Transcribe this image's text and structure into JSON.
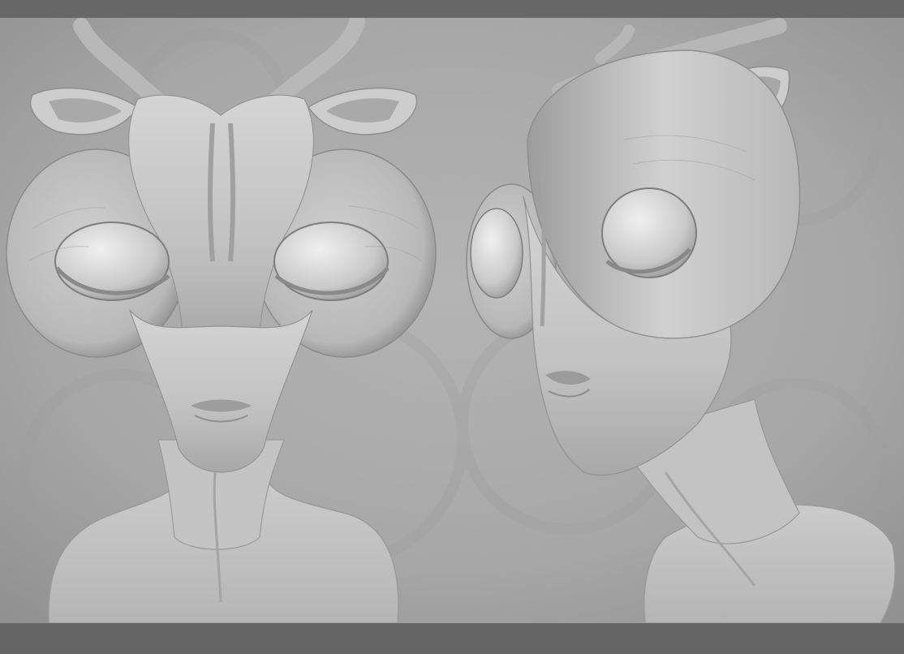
{
  "scene": {
    "subject": "alien-head-sculpt-render",
    "views": [
      "front-view",
      "three-quarter-view"
    ],
    "colors": {
      "frame": "#666666",
      "background": "#a9a9a9",
      "clay": "#c8c8c8",
      "clay_shadow": "#8e8e8e",
      "clay_highlight": "#e6e6e6"
    }
  }
}
